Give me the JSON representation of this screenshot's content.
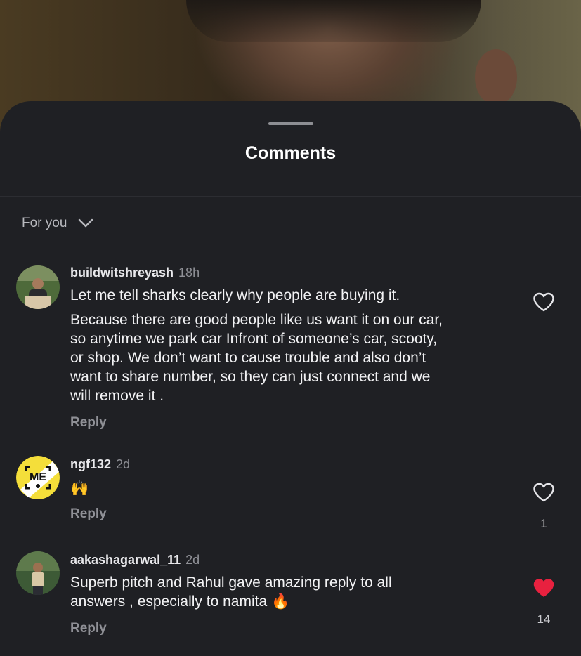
{
  "sheet": {
    "title": "Comments"
  },
  "sort": {
    "label": "For you"
  },
  "comments": [
    {
      "username": "buildwitshreyash",
      "time": "18h",
      "lines": [
        "Let me tell sharks clearly why people are buying it.",
        "Because there are good people like us want it on our car,",
        "so anytime we park car Infront of someone’s car, scooty,",
        "or shop. We don’t want to cause trouble and also don’t",
        "want to share number, so they can just connect and we",
        "will remove it ."
      ],
      "reply_label": "Reply",
      "liked": false
    },
    {
      "username": "ngf132",
      "time": "2d",
      "text": "🙌",
      "reply_label": "Reply",
      "like_count": "1",
      "liked": false,
      "avatar_text": "ME"
    },
    {
      "username": "aakashagarwal_11",
      "time": "2d",
      "lines": [
        "Superb pitch and Rahul gave amazing reply to all",
        "answers , especially to namita 🔥"
      ],
      "reply_label": "Reply",
      "like_count": "14",
      "liked": true
    }
  ],
  "colors": {
    "like_active": "#e8213f",
    "sheet_bg": "#1f2024",
    "muted_text": "#8f9096"
  },
  "icons": {
    "sort": "chevron-down-icon",
    "like": "heart-icon"
  }
}
